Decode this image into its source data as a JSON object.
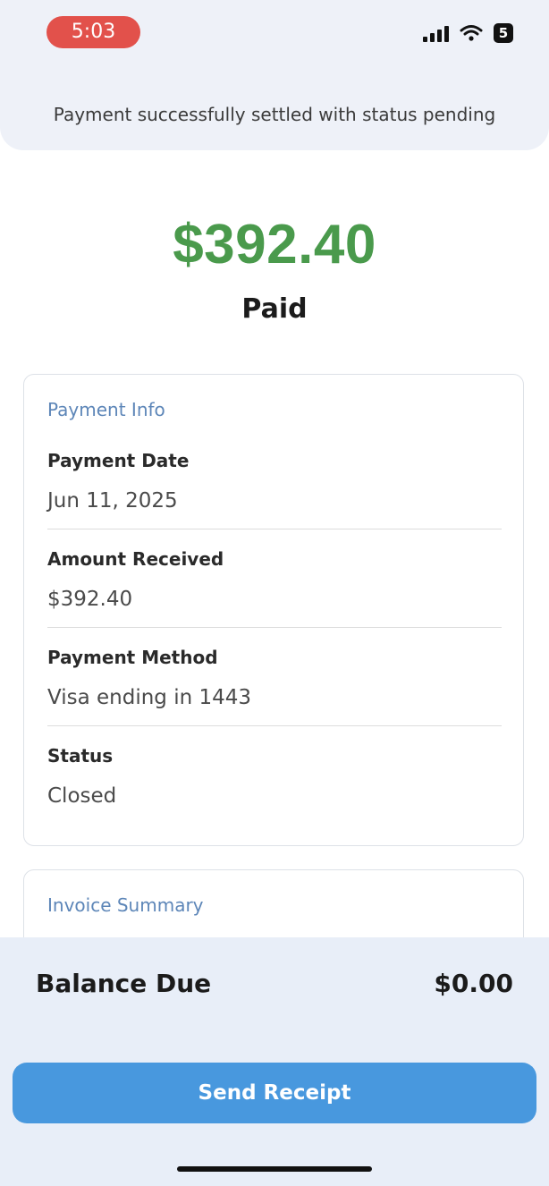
{
  "status_bar": {
    "time": "5:03",
    "battery": "5",
    "icons": [
      "signal-icon",
      "wifi-icon",
      "battery-icon"
    ]
  },
  "banner": {
    "message": "Payment successfully settled with status pending"
  },
  "summary": {
    "amount": "$392.40",
    "state": "Paid",
    "amount_color": "#4a9a4c"
  },
  "payment_info": {
    "title": "Payment Info",
    "fields": [
      {
        "label": "Payment Date",
        "value": "Jun 11, 2025"
      },
      {
        "label": "Amount Received",
        "value": "$392.40"
      },
      {
        "label": "Payment Method",
        "value": "Visa ending in 1443"
      },
      {
        "label": "Status",
        "value": "Closed"
      }
    ]
  },
  "invoice_summary": {
    "title": "Invoice Summary"
  },
  "footer": {
    "balance_label": "Balance Due",
    "balance_value": "$0.00",
    "send_receipt_label": "Send Receipt",
    "button_color": "#4898de"
  }
}
